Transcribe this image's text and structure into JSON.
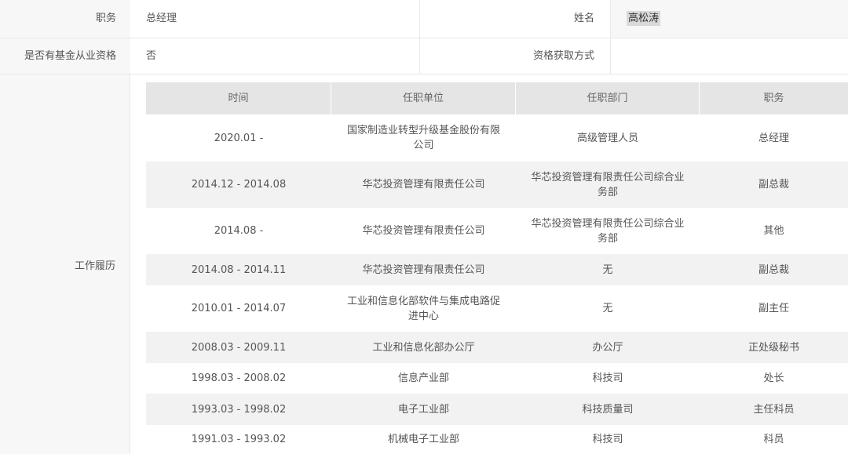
{
  "info": {
    "position_label": "职务",
    "position_value": "总经理",
    "name_label": "姓名",
    "name_value": "高松涛",
    "fund_qual_label": "是否有基金从业资格",
    "fund_qual_value": "否",
    "qual_method_label": "资格获取方式",
    "qual_method_value": ""
  },
  "work_history": {
    "label": "工作履历",
    "headers": [
      "时间",
      "任职单位",
      "任职部门",
      "职务"
    ],
    "rows": [
      {
        "time": "2020.01 -",
        "org": "国家制造业转型升级基金股份有限公司",
        "dept": "高级管理人员",
        "title": "总经理"
      },
      {
        "time": "2014.12 - 2014.08",
        "org": "华芯投资管理有限责任公司",
        "dept": "华芯投资管理有限责任公司综合业务部",
        "title": "副总裁"
      },
      {
        "time": "2014.08 -",
        "org": "华芯投资管理有限责任公司",
        "dept": "华芯投资管理有限责任公司综合业务部",
        "title": "其他"
      },
      {
        "time": "2014.08 - 2014.11",
        "org": "华芯投资管理有限责任公司",
        "dept": "无",
        "title": "副总裁"
      },
      {
        "time": "2010.01 - 2014.07",
        "org": "工业和信息化部软件与集成电路促进中心",
        "dept": "无",
        "title": "副主任"
      },
      {
        "time": "2008.03 - 2009.11",
        "org": "工业和信息化部办公厅",
        "dept": "办公厅",
        "title": "正处级秘书"
      },
      {
        "time": "1998.03 - 2008.02",
        "org": "信息产业部",
        "dept": "科技司",
        "title": "处长"
      },
      {
        "time": "1993.03 - 1998.02",
        "org": "电子工业部",
        "dept": "科技质量司",
        "title": "主任科员"
      },
      {
        "time": "1991.03 - 1993.02",
        "org": "机械电子工业部",
        "dept": "科技司",
        "title": "科员"
      }
    ]
  }
}
